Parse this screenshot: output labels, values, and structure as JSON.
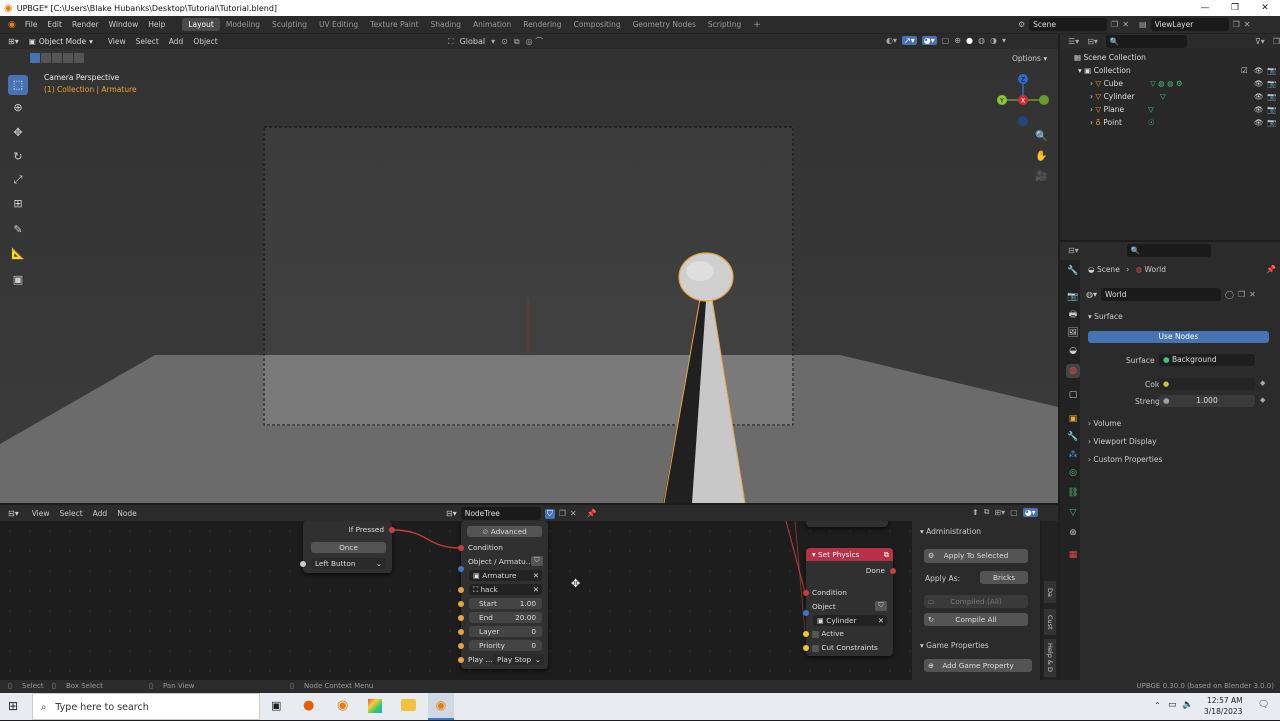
{
  "window": {
    "title": "UPBGE* [C:\\Users\\Blake Hubanks\\Desktop\\Tutorial\\Tutorial.blend]"
  },
  "menu": [
    "File",
    "Edit",
    "Render",
    "Window",
    "Help"
  ],
  "workspaces": [
    "Layout",
    "Modeling",
    "Sculpting",
    "UV Editing",
    "Texture Paint",
    "Shading",
    "Animation",
    "Rendering",
    "Compositing",
    "Geometry Nodes",
    "Scripting"
  ],
  "active_workspace": "Layout",
  "scene_field": "Scene",
  "viewlayer_field": "ViewLayer",
  "viewport": {
    "mode": "Object Mode",
    "menus": [
      "View",
      "Select",
      "Add",
      "Object"
    ],
    "transform": "Global",
    "options_label": "Options",
    "overlay_title": "Camera Perspective",
    "overlay_sub": "(1) Collection | Armature",
    "gizmo_axes": {
      "x": "X",
      "y": "Y",
      "z": "Z"
    }
  },
  "outliner": {
    "root": "Scene Collection",
    "collection": "Collection",
    "items": [
      "Cube",
      "Cylinder",
      "Plane",
      "Point"
    ]
  },
  "properties": {
    "breadcrumb": {
      "scene": "Scene",
      "world": "World"
    },
    "world_name": "World",
    "surface_panel": "Surface",
    "use_nodes": "Use Nodes",
    "surface_label": "Surface",
    "surface_value": "Background",
    "color_label": "Color",
    "strength_label": "Strength",
    "strength_value": "1.000",
    "subpanels": [
      "Volume",
      "Viewport Display",
      "Custom Properties"
    ]
  },
  "node_editor": {
    "menus": [
      "View",
      "Select",
      "Add",
      "Node"
    ],
    "tree_name": "NodeTree",
    "mouse_node": {
      "output": "If Pressed",
      "mode": "Once",
      "button": "Left Button"
    },
    "action_node": {
      "advanced": "Advanced",
      "condition": "Condition",
      "object_label": "Object / Armatu...",
      "object_value": "Armature",
      "action_value": "hack",
      "start_label": "Start",
      "start_value": "1.00",
      "end_label": "End",
      "end_value": "20.00",
      "layer_label": "Layer",
      "layer_value": "0",
      "priority_label": "Priority",
      "priority_value": "0",
      "play_label": "Play ...",
      "play_value": "Play Stop"
    },
    "physics_node": {
      "title": "Set Physics",
      "done": "Done",
      "condition": "Condition",
      "object_label": "Object",
      "object_value": "Cylinder",
      "active": "Active",
      "cut": "Cut Constraints"
    },
    "sidebar": {
      "admin": "Administration",
      "apply_selected": "Apply To Selected",
      "apply_as_label": "Apply As:",
      "apply_as_value": "Bricks",
      "compiled": "Compiled (All)",
      "compile_all": "Compile All",
      "game_props": "Game Properties",
      "add_prop": "Add Game Property"
    },
    "side_tabs": [
      "Da",
      "Cust",
      "Help & D"
    ]
  },
  "status": {
    "select": "Select",
    "box_select": "Box Select",
    "pan_view": "Pan View",
    "context_menu": "Node Context Menu",
    "version": "UPBGE 0.30.0 (based on Blender 3.0.0)"
  },
  "taskbar": {
    "search_placeholder": "Type here to search",
    "time": "12:57 AM",
    "date": "3/18/2023"
  },
  "colors": {
    "accent": "#4772b3",
    "selection": "#e8a33d",
    "node_header_red": "#b83047"
  }
}
